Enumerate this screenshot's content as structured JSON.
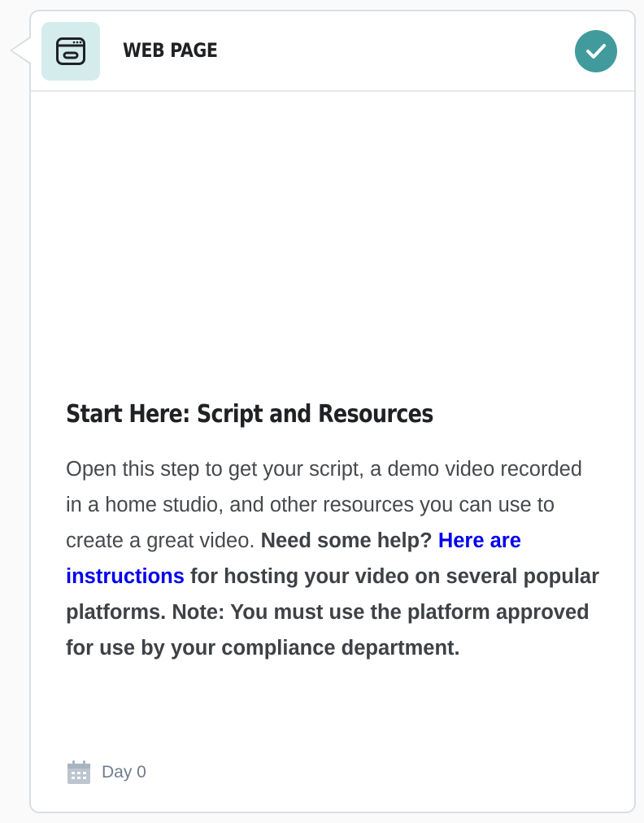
{
  "step": {
    "type_label": "WEB PAGE",
    "completed": true,
    "title": "Start Here: Script and Resources",
    "description_plain": "Open this step to get your script, a demo video recorded in a home studio, and other resources you can use to create a great video.",
    "help_prompt": "Need some help?",
    "link_text": "Here are instructions",
    "description_after_link": "for hosting your video on several popular platforms. Note: You must use the platform approved for use by your compliance department.",
    "day_label": "Day 0"
  },
  "icons": {
    "type_icon": "browser-window-icon",
    "status_icon": "check-icon",
    "day_icon": "calendar-icon"
  },
  "colors": {
    "accent": "#419b9c",
    "icon_tile_bg": "#d5ecec",
    "link": "#0000ee",
    "muted": "#6f7c8c",
    "heading": "#1f2124"
  }
}
